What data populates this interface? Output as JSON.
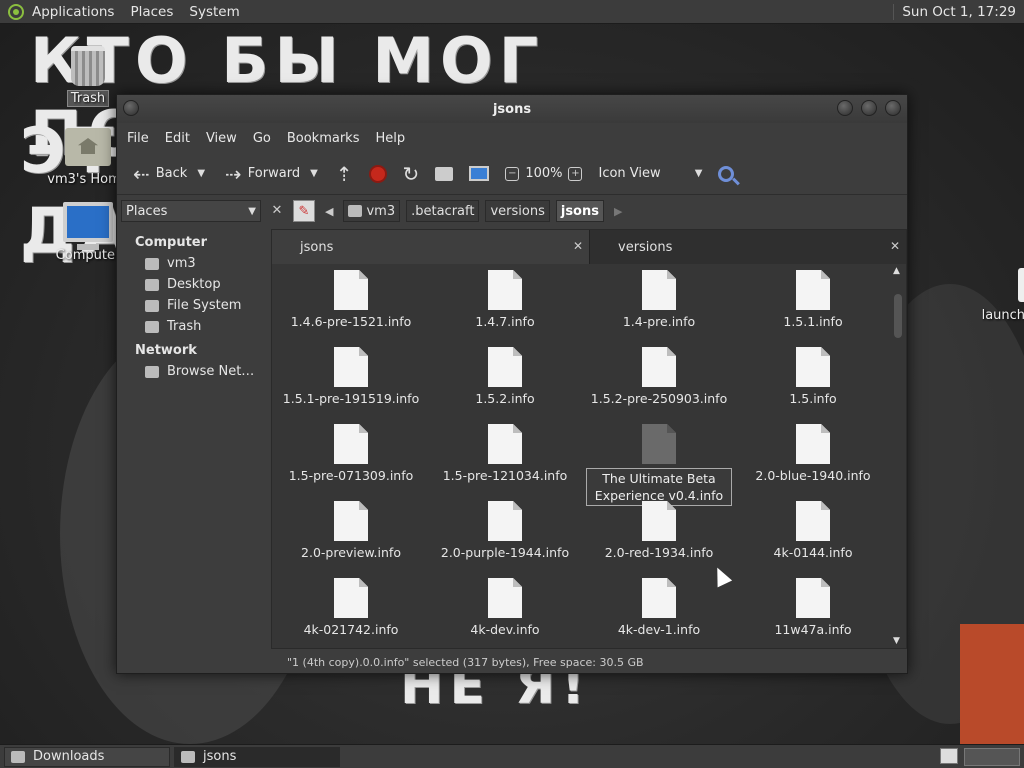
{
  "top_panel": {
    "menus": [
      "Applications",
      "Places",
      "System"
    ],
    "clock": "Sun Oct  1, 17:29"
  },
  "wallpaper": {
    "line1": "КТО БЫ МОГ ПОДУМАТЬ, ЧТО Я –",
    "line2": "ЭТО",
    "line3": "ДА",
    "line4": "НЕ Я!"
  },
  "desktop_icons": {
    "trash": "Trash",
    "home": "vm3's Home",
    "computer": "Computer",
    "launcher": "launcher"
  },
  "window": {
    "title": "jsons",
    "menu": [
      "File",
      "Edit",
      "View",
      "Go",
      "Bookmarks",
      "Help"
    ],
    "toolbar": {
      "back": "Back",
      "forward": "Forward",
      "zoom": "100%",
      "view_mode": "Icon View"
    },
    "places_label": "Places",
    "breadcrumbs": [
      "vm3",
      ".betacraft",
      "versions",
      "jsons"
    ],
    "sidebar": {
      "computer_header": "Computer",
      "computer_items": [
        "vm3",
        "Desktop",
        "File System",
        "Trash"
      ],
      "network_header": "Network",
      "network_items": [
        "Browse Net…"
      ]
    },
    "tabs": [
      "jsons",
      "versions"
    ],
    "files": [
      "1.4.6-pre-1521.info",
      "1.4.7.info",
      "1.4-pre.info",
      "1.5.1.info",
      "1.5.1-pre-191519.info",
      "1.5.2.info",
      "1.5.2-pre-250903.info",
      "1.5.info",
      "1.5-pre-071309.info",
      "1.5-pre-121034.info",
      "The Ultimate Beta Experience v0.4.info",
      "2.0-blue-1940.info",
      "2.0-preview.info",
      "2.0-purple-1944.info",
      "2.0-red-1934.info",
      "4k-0144.info",
      "4k-021742.info",
      "4k-dev.info",
      "4k-dev-1.info",
      "11w47a.info"
    ],
    "rename_line1": "The Ultimate Beta",
    "rename_line2": "Experience v0.4.info",
    "status": "\"1 (4th copy).0.0.info\" selected (317 bytes), Free space: 30.5 GB"
  },
  "taskbar": [
    "Downloads",
    "jsons"
  ]
}
